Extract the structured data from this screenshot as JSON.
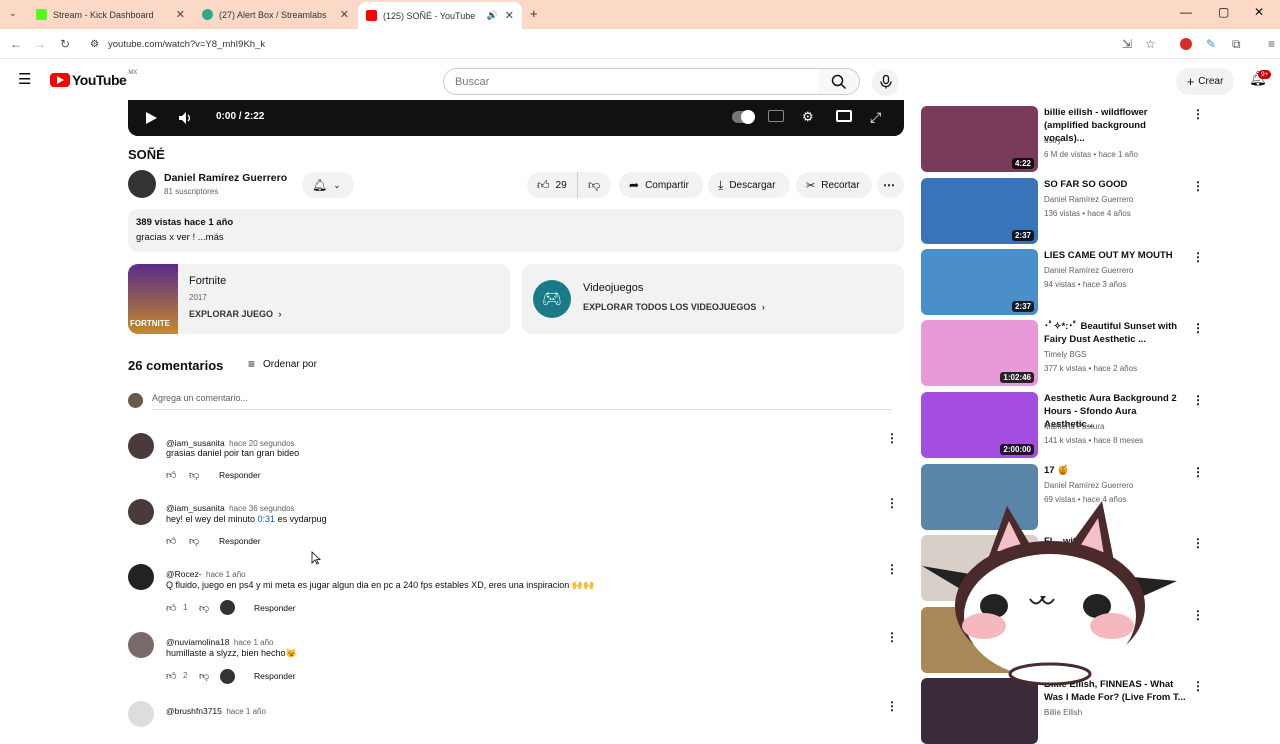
{
  "browser": {
    "tabs": [
      {
        "title": "Stream - Kick Dashboard",
        "color": "#53fc18"
      },
      {
        "title": "(27) Alert Box / Streamlabs",
        "color": "#2ea98d"
      },
      {
        "title": "(125) SOÑÉ - YouTube",
        "color": "#ff0000"
      }
    ],
    "url": "youtube.com/watch?v=Y8_mhI9Kh_k"
  },
  "header": {
    "logo_text": "YouTube",
    "region": "MX",
    "search_placeholder": "Buscar",
    "create_label": "Crear",
    "notif_count": "9+"
  },
  "player": {
    "time": "0:00 / 2:22"
  },
  "video": {
    "title": "SOÑÉ",
    "channel": "Daniel Ramírez Guerrero",
    "subscribers": "81 suscriptores",
    "likes": "29",
    "share": "Compartir",
    "download": "Descargar",
    "clip": "Recortar",
    "views_date": "389 vistas  hace 1 año",
    "description": "gracias x ver ! ...más"
  },
  "cards": {
    "game_title": "Fortnite",
    "game_year": "2017",
    "game_link": "EXPLORAR JUEGO",
    "game_thumb_text": "FORTNITE",
    "cat_title": "Videojuegos",
    "cat_link": "EXPLORAR TODOS LOS VIDEOJUEGOS"
  },
  "comments": {
    "count_label": "26 comentarios",
    "sort_label": "Ordenar por",
    "add_placeholder": "Agrega un comentario...",
    "reply_label": "Responder",
    "items": [
      {
        "user": "@iam_susanita",
        "time": "hace 20 segundos",
        "text": "grasias daniel poir tan gran bideo",
        "likes": ""
      },
      {
        "user": "@iam_susanita",
        "time": "hace 36 segundos",
        "text_pre": "hey! el wey del minuto ",
        "link": "0:31",
        "text_post": " es vydarpug",
        "likes": ""
      },
      {
        "user": "@Rocez-",
        "time": "hace 1 año",
        "text": "Q fluido, juego en ps4 y mi meta es jugar algun dia en pc a 240 fps estables XD, eres una inspiracion 🙌🙌",
        "likes": "1"
      },
      {
        "user": "@nuviamolina18",
        "time": "hace 1 año",
        "text": "humillaste a slyzz, bien hecho😼",
        "likes": "2"
      },
      {
        "user": "@brushfn3715",
        "time": "hace 1 año"
      }
    ]
  },
  "sidebar": [
    {
      "title": "billie eilish - wildflower (amplified background vocals)...",
      "channel": "ustry",
      "meta": "6 M de vistas • hace 1 año",
      "duration": "4:22",
      "color": "#7a3a5a"
    },
    {
      "title": "SO FAR SO GOOD",
      "channel": "Daniel Ramírez Guerrero",
      "meta": "136 vistas • hace 4 años",
      "duration": "2:37",
      "color": "#3a74b8"
    },
    {
      "title": "LIES CAME OUT MY MOUTH",
      "channel": "Daniel Ramírez Guerrero",
      "meta": "94 vistas • hace 3 años",
      "duration": "2:37",
      "color": "#4a8fc8"
    },
    {
      "title": "･ﾟ✧*:･ﾟ Beautiful Sunset with Fairy Dust Aesthetic ...",
      "channel": "Timely BGS",
      "meta": "377 k vistas • hace 2 años",
      "duration": "1:02:46",
      "color": "#e89ad8"
    },
    {
      "title": "Aesthetic Aura Background 2 Hours - Sfondo Aura Aesthetic...",
      "channel": "Marilena Pastura",
      "meta": "141 k vistas • hace 8 meses",
      "duration": "2:00:00",
      "color": "#a34ee0"
    },
    {
      "title": "17 🍯",
      "channel": "Daniel Ramírez Guerrero",
      "meta": "69 vistas • hace 4 años",
      "duration": "",
      "color": "#5a84a8"
    },
    {
      "title": "Fl... with warm",
      "channel": "",
      "meta": "",
      "duration": "",
      "color": "#d8d0c8"
    },
    {
      "title": "...saver | ...utumn ar...",
      "channel": "",
      "meta": "hace 1 año",
      "duration": "",
      "color": "#a88858"
    },
    {
      "title": "Billie Eilish, FINNEAS - What Was I Made For? (Live From T...",
      "channel": "Billie Eilish",
      "meta": "",
      "duration": "",
      "color": "#3a2a3a"
    }
  ]
}
